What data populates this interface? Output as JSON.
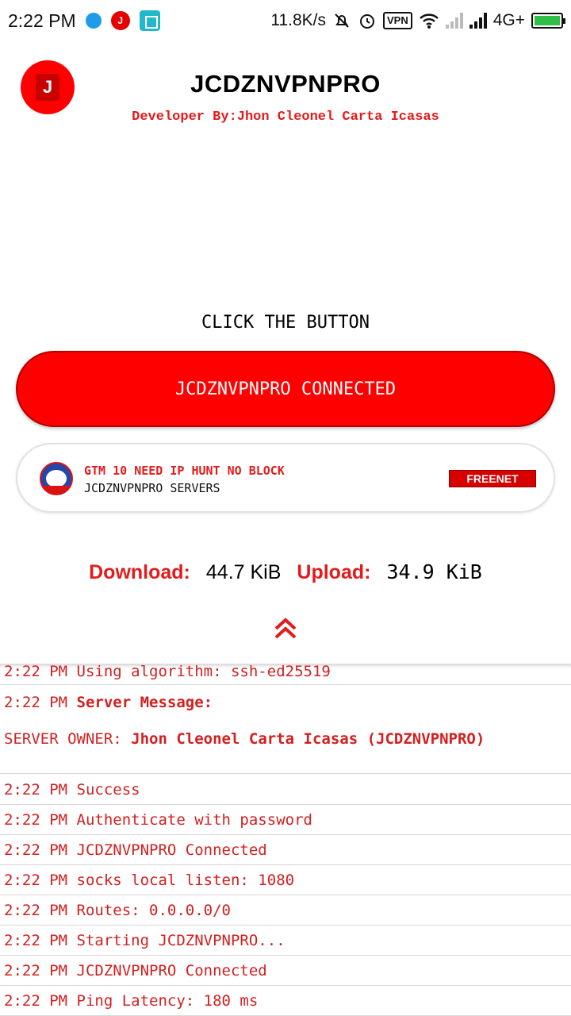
{
  "status_bar": {
    "time": "2:22 PM",
    "network_speed": "11.8K/s",
    "vpn": "VPN",
    "network_type": "4G+",
    "icons": [
      "messenger-icon",
      "app-j-icon",
      "screen-record-icon",
      "mute-bell-icon",
      "alarm-icon",
      "vpn-icon",
      "wifi-icon",
      "signal-icon",
      "battery-icon"
    ],
    "colors": {
      "battery": "#2fbf47",
      "messenger": "#1e9be9",
      "screen_record": "#21b8c9"
    }
  },
  "header": {
    "logo_letter": "J",
    "title": "JCDZNVPNPRO",
    "developer": "Developer By:Jhon Cleonel Carta Icasas"
  },
  "main": {
    "instruction": "CLICK THE BUTTON",
    "connect_button": "JCDZNVPNPRO CONNECTED",
    "server": {
      "name": "GTM 10 NEED IP HUNT NO BLOCK",
      "subtitle": "JCDZNVPNPRO SERVERS",
      "badge": "FREENET",
      "icon": "server-flag-icon"
    },
    "stats": {
      "download_label": "Download:",
      "download_value": "44.7 KiB",
      "upload_label": "Upload:",
      "upload_value": "34.9 KiB"
    },
    "expand_icon": "double-chevron-up-icon"
  },
  "colors": {
    "accent": "#ff0000",
    "text_red": "#e31b1b",
    "log_red": "#d31f1f"
  },
  "log": [
    {
      "time": "2:22 PM",
      "text": "Using algorithm: ssh-ed25519"
    },
    {
      "time": "2:22 PM",
      "text": "Server Message:"
    },
    {
      "prefix": "SERVER OWNER:",
      "text": "Jhon Cleonel Carta Icasas (JCDZNVPNPRO)"
    },
    {
      "time": "2:22 PM",
      "text": "Success"
    },
    {
      "time": "2:22 PM",
      "text": "Authenticate with password"
    },
    {
      "time": "2:22 PM",
      "text": "JCDZNVPNPRO Connected"
    },
    {
      "time": "2:22 PM",
      "text": "socks local listen: 1080"
    },
    {
      "time": "2:22 PM",
      "text": "Routes: 0.0.0.0/0"
    },
    {
      "time": "2:22 PM",
      "text": "Starting JCDZNVPNPRO..."
    },
    {
      "time": "2:22 PM",
      "text": "JCDZNVPNPRO Connected"
    },
    {
      "time": "2:22 PM",
      "text": "Ping Latency: 180 ms"
    }
  ]
}
